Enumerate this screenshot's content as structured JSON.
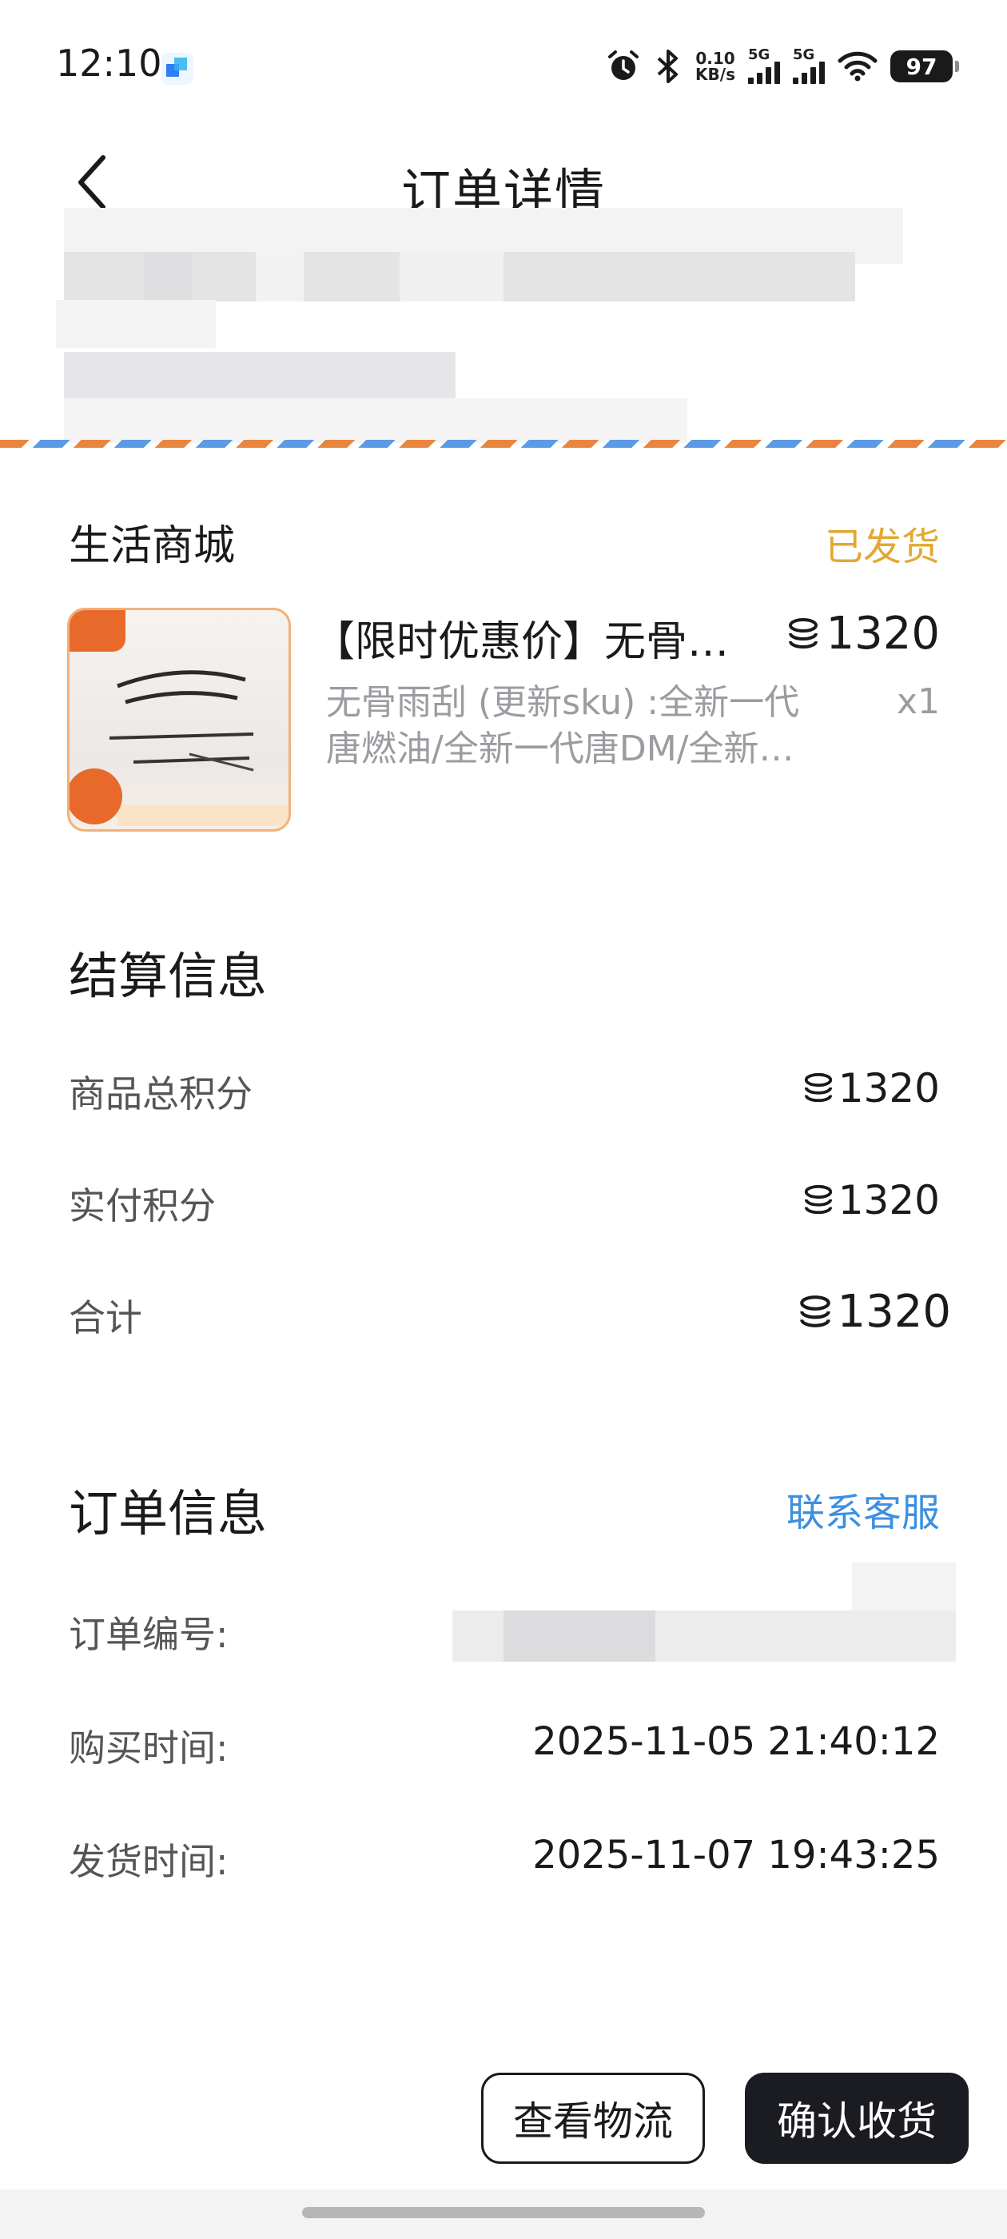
{
  "status_bar": {
    "time": "12:10",
    "app_icon": "app-notification-icon",
    "net_speed_value": "0.10",
    "net_speed_unit": "KB/s",
    "sim1_label": "5G",
    "sim2_label": "5G",
    "battery": "97",
    "icons": [
      "alarm-icon",
      "bluetooth-icon",
      "signal-icon",
      "wifi-icon",
      "battery-icon"
    ]
  },
  "header": {
    "title": "订单详情",
    "back_icon": "back-chevron-icon"
  },
  "shop": {
    "name": "生活商城",
    "status": "已发货",
    "status_color": "#e2a832"
  },
  "product": {
    "title": "【限时优惠价】无骨…",
    "price": "1320",
    "price_icon": "points-coin-icon",
    "sku_line1": "无骨雨刮 (更新sku) :全新一代",
    "sku_line2": "唐燃油/全新一代唐DM/全新…",
    "quantity": "x1"
  },
  "settlement": {
    "title": "结算信息",
    "rows": [
      {
        "label": "商品总积分",
        "value": "1320"
      },
      {
        "label": "实付积分",
        "value": "1320"
      },
      {
        "label": "合计",
        "value": "1320"
      }
    ]
  },
  "order_info": {
    "title": "订单信息",
    "contact_label": "联系客服",
    "contact_color": "#3d8fe0",
    "order_no_label": "订单编号:",
    "purchase_time_label": "购买时间:",
    "purchase_time": "2025-11-05 21:40:12",
    "ship_time_label": "发货时间:",
    "ship_time": "2025-11-07 19:43:25"
  },
  "actions": {
    "logistics": "查看物流",
    "confirm": "确认收货"
  }
}
